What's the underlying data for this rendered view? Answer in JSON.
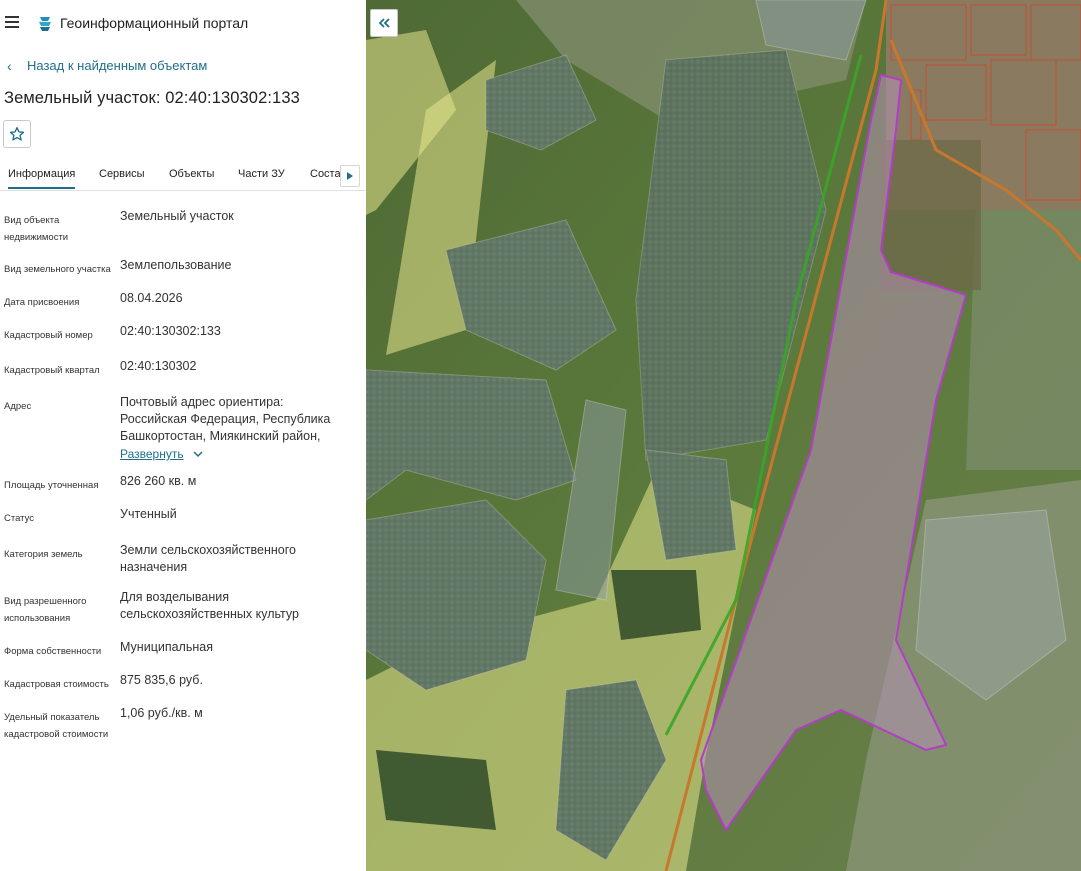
{
  "app": {
    "title": "Геоинформационный портал"
  },
  "nav": {
    "back_label": "Назад к найденным объектам"
  },
  "object": {
    "title": "Земельный участок: 02:40:130302:133"
  },
  "tabs": [
    {
      "label": "Информация",
      "active": true
    },
    {
      "label": "Сервисы"
    },
    {
      "label": "Объекты"
    },
    {
      "label": "Части ЗУ"
    },
    {
      "label": "Соста"
    }
  ],
  "properties": [
    {
      "key": "Вид объекта недвижимости",
      "value": "Земельный участок"
    },
    {
      "key": "Вид земельного участка",
      "value": "Землепользование"
    },
    {
      "key": "Дата присвоения",
      "value": "08.04.2026"
    },
    {
      "key": "Кадастровый номер",
      "value": "02:40:130302:133"
    },
    {
      "key": "Кадастровый квартал",
      "value": "02:40:130302"
    },
    {
      "key": "Адрес",
      "value": "Почтовый адрес ориентира: Российская Федерация, Республика Башкортостан, Миякинский район,",
      "expand_label": "Развернуть"
    },
    {
      "key": "Площадь уточненная",
      "value": "826 260 кв. м"
    },
    {
      "key": "Статус",
      "value": "Учтенный"
    },
    {
      "key": "Категория земель",
      "value": "Земли сельскохозяйственного назначения"
    },
    {
      "key": "Вид разрешенного использования",
      "value": "Для возделывания сельскохозяйственных культур"
    },
    {
      "key": "Форма собственности",
      "value": "Муниципальная"
    },
    {
      "key": "Кадастровая стоимость",
      "value": "875 835,6 руб."
    },
    {
      "key": "Удельный показатель кадастровой стоимости",
      "value": "1,06 руб./кв. м"
    }
  ],
  "icons": {
    "menu": "hamburger-icon",
    "logo": "portal-logo-icon",
    "back": "chevron-left-icon",
    "favorite": "star-outline-icon",
    "tabs_scroll": "triangle-right-icon",
    "collapse": "double-chevron-left-icon",
    "expand": "chevron-down-icon"
  },
  "colors": {
    "accent": "#1f6f8b",
    "parcel_outline": "#b43cc8",
    "parcel_fill": "#b491b4",
    "zone_fill": "#e6e68c",
    "forest_overlay": "#8c9aa3",
    "road": "#c8782d",
    "green_line": "#39a528"
  }
}
